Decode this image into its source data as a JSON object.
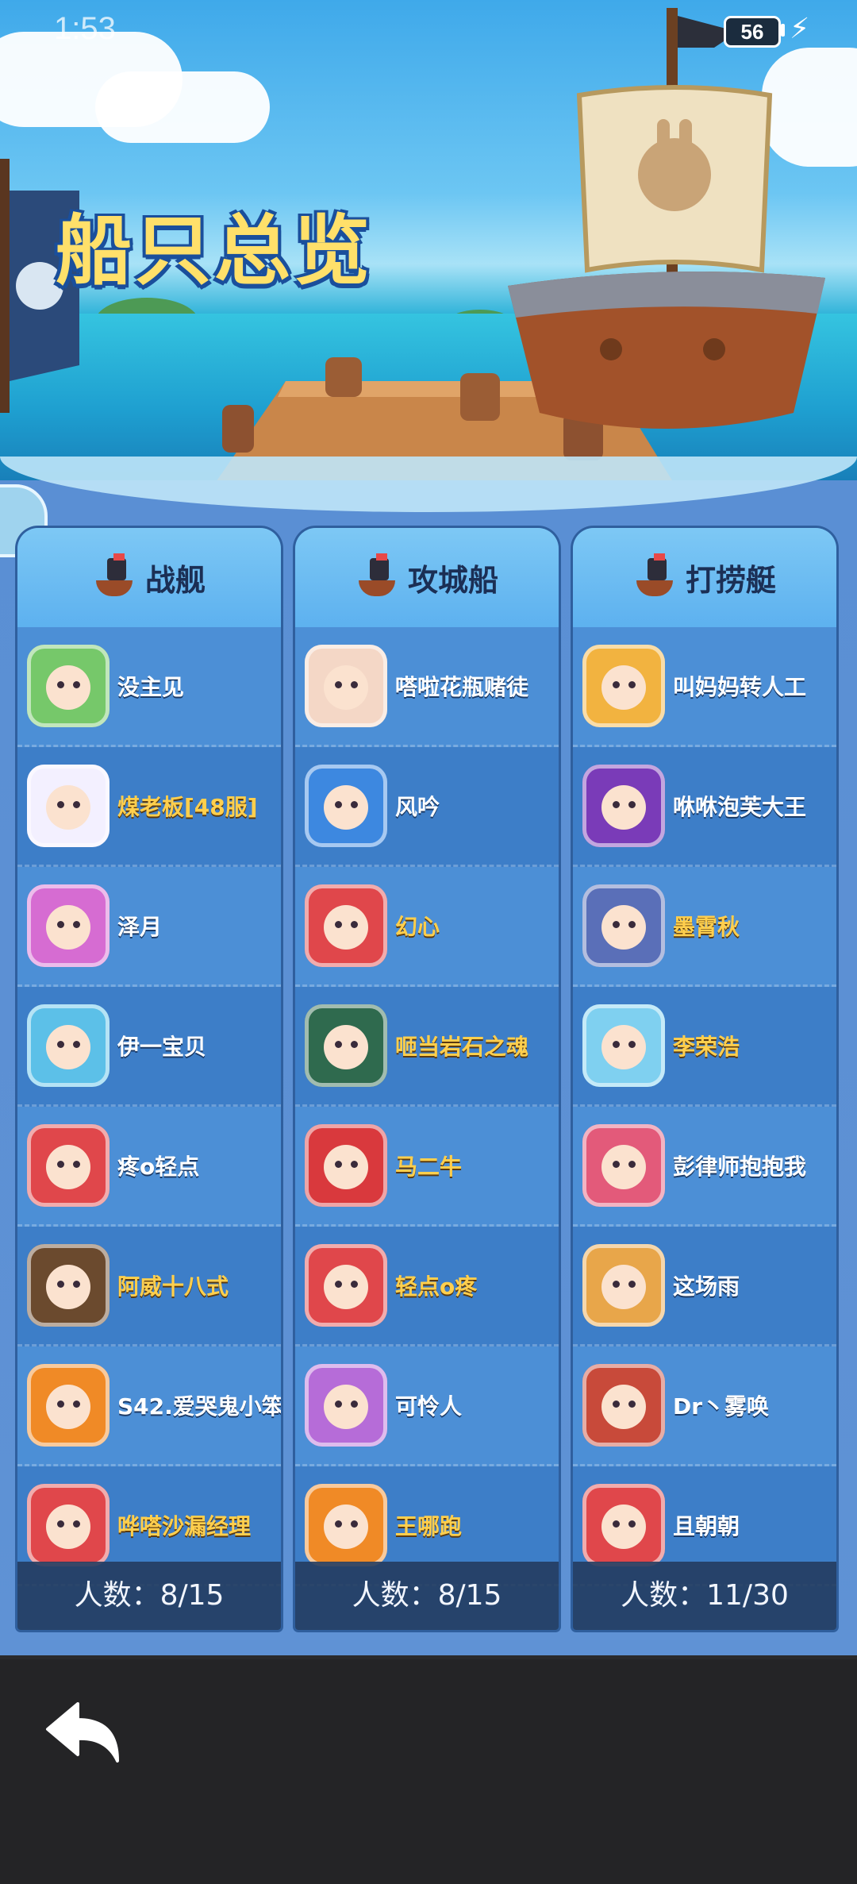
{
  "status_bar": {
    "time": "1:53",
    "battery": "56"
  },
  "page_title": "船只总览",
  "columns": [
    {
      "title": "战舰",
      "count_text": "人数：8/15",
      "members": [
        {
          "name": "没主见",
          "color": "white",
          "avatar_bg": "#76c86a"
        },
        {
          "name": "煤老板[48服]",
          "color": "gold",
          "avatar_bg": "#f3f0ff"
        },
        {
          "name": "泽月",
          "color": "white",
          "avatar_bg": "#d66cd2"
        },
        {
          "name": "伊一宝贝",
          "color": "white",
          "avatar_bg": "#5cc0e8"
        },
        {
          "name": "疼o轻点",
          "color": "white",
          "avatar_bg": "#e0474b"
        },
        {
          "name": "阿威十八式",
          "color": "gold",
          "avatar_bg": "#6b4a2e"
        },
        {
          "name": "S42.爱哭鬼小笨",
          "color": "white",
          "avatar_bg": "#f08a26"
        },
        {
          "name": "哗嗒沙漏经理",
          "color": "gold",
          "avatar_bg": "#e0474b"
        }
      ]
    },
    {
      "title": "攻城船",
      "count_text": "人数：8/15",
      "members": [
        {
          "name": "嗒啦花瓶赌徒",
          "color": "white",
          "avatar_bg": "#f4d7c6"
        },
        {
          "name": "风吟",
          "color": "white",
          "avatar_bg": "#3d88e0"
        },
        {
          "name": "幻心",
          "color": "gold",
          "avatar_bg": "#e0474b"
        },
        {
          "name": "咂当岩石之魂",
          "color": "gold",
          "avatar_bg": "#2f6a4e"
        },
        {
          "name": "马二牛",
          "color": "gold",
          "avatar_bg": "#d9393d"
        },
        {
          "name": "轻点o疼",
          "color": "gold",
          "avatar_bg": "#e0474b"
        },
        {
          "name": "可怜人",
          "color": "white",
          "avatar_bg": "#b66cd8"
        },
        {
          "name": "王哪跑",
          "color": "gold",
          "avatar_bg": "#f08a26"
        }
      ]
    },
    {
      "title": "打捞艇",
      "count_text": "人数：11/30",
      "members": [
        {
          "name": "叫妈妈转人工",
          "color": "white",
          "avatar_bg": "#f2b340"
        },
        {
          "name": "咻咻泡芙大王",
          "color": "white",
          "avatar_bg": "#7a3bb8"
        },
        {
          "name": "墨霄秋",
          "color": "gold",
          "avatar_bg": "#5a6fb8"
        },
        {
          "name": "李荣浩",
          "color": "gold",
          "avatar_bg": "#7fd0f0"
        },
        {
          "name": "彭律师抱抱我",
          "color": "white",
          "avatar_bg": "#e35a7a"
        },
        {
          "name": "这场雨",
          "color": "white",
          "avatar_bg": "#e8a64a"
        },
        {
          "name": "Dr丶雾唤",
          "color": "white",
          "avatar_bg": "#c84a3a"
        },
        {
          "name": "且朝朝",
          "color": "white",
          "avatar_bg": "#e0474b"
        }
      ]
    }
  ]
}
